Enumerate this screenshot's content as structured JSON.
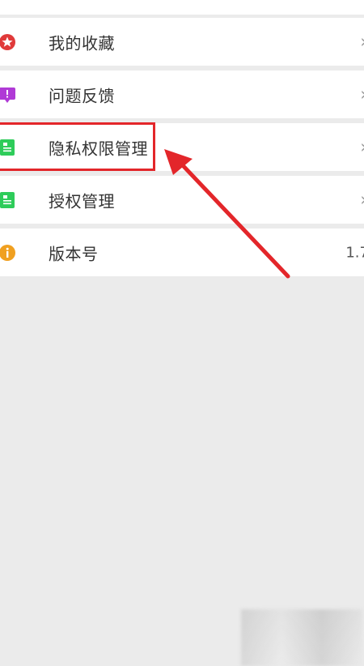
{
  "menu": {
    "items": [
      {
        "label": "我的收藏",
        "icon": "favorites-star-icon",
        "icon_color": "#e03a3a",
        "trailing": "›"
      },
      {
        "label": "问题反馈",
        "icon": "feedback-icon",
        "icon_color": "#b03ad6",
        "trailing": "›"
      },
      {
        "label": "隐私权限管理",
        "icon": "privacy-doc-icon",
        "icon_color": "#2ecc5a",
        "trailing": "›"
      },
      {
        "label": "授权管理",
        "icon": "authorization-doc-icon",
        "icon_color": "#2ecc5a",
        "trailing": "›"
      },
      {
        "label": "版本号",
        "icon": "info-icon",
        "icon_color": "#f0a020",
        "value": "1.7"
      }
    ]
  },
  "annotation": {
    "highlight_color": "#e3262a"
  },
  "colors": {
    "background": "#ebebeb",
    "row_background": "#ffffff",
    "text": "#333333",
    "chevron": "#9a9a9a"
  }
}
